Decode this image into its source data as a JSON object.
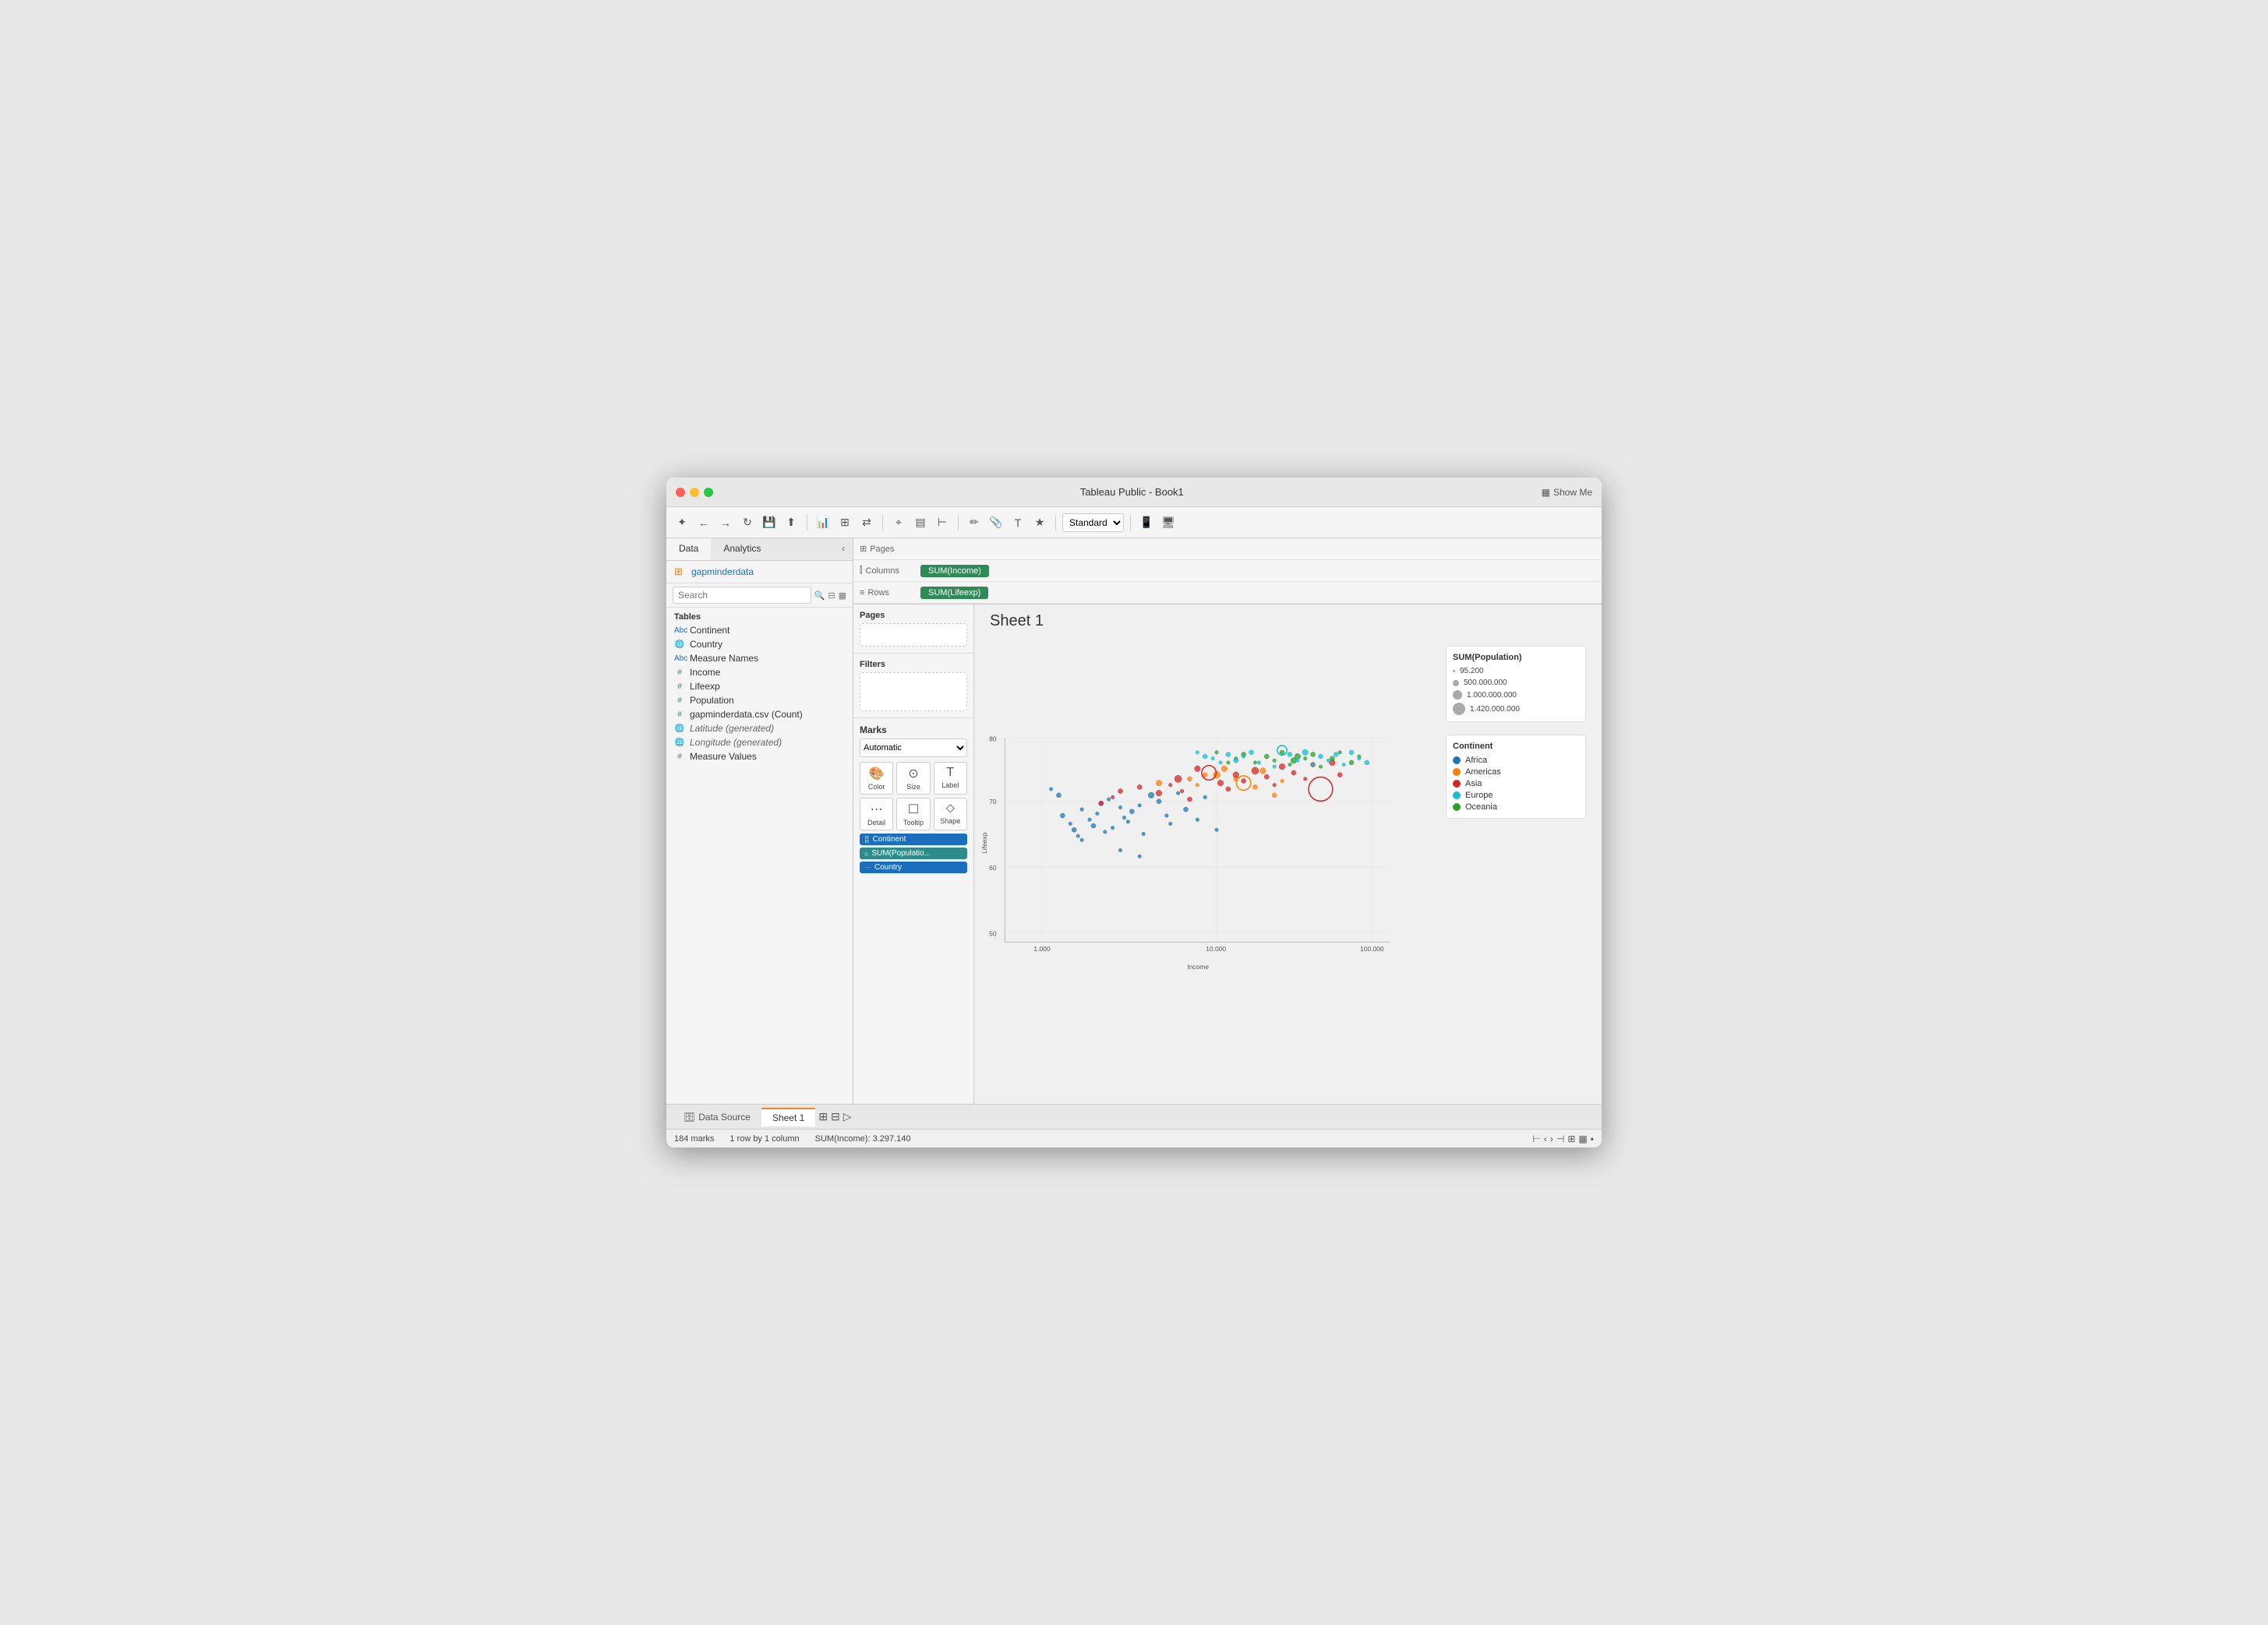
{
  "window": {
    "title": "Tableau Public - Book1"
  },
  "toolbar": {
    "standard_label": "Standard",
    "show_me_label": "Show Me"
  },
  "data_panel": {
    "tab_data": "Data",
    "tab_analytics": "Analytics",
    "datasource": "gapminderdata",
    "search_placeholder": "Search",
    "tables_label": "Tables",
    "fields": [
      {
        "name": "Continent",
        "type": "abc",
        "color": "blue"
      },
      {
        "name": "Country",
        "type": "globe",
        "color": "blue"
      },
      {
        "name": "Measure Names",
        "type": "abc",
        "color": "blue"
      },
      {
        "name": "Income",
        "type": "hash",
        "color": "green"
      },
      {
        "name": "Lifeexp",
        "type": "hash",
        "color": "green"
      },
      {
        "name": "Population",
        "type": "hash",
        "color": "green"
      },
      {
        "name": "gapminderdata.csv (Count)",
        "type": "hash",
        "color": "green"
      },
      {
        "name": "Latitude (generated)",
        "type": "globe",
        "color": "green",
        "italic": true
      },
      {
        "name": "Longitude (generated)",
        "type": "globe",
        "color": "green",
        "italic": true
      },
      {
        "name": "Measure Values",
        "type": "hash",
        "color": "green"
      }
    ]
  },
  "pages_panel": {
    "title": "Pages"
  },
  "filters_panel": {
    "title": "Filters"
  },
  "shelves": {
    "columns_label": "Columns",
    "columns_pill": "SUM(Income)",
    "rows_label": "Rows",
    "rows_pill": "SUM(Lifeexp)"
  },
  "marks": {
    "title": "Marks",
    "type": "Automatic",
    "buttons": [
      {
        "label": "Color",
        "icon": "🎨"
      },
      {
        "label": "Size",
        "icon": "⊙"
      },
      {
        "label": "Label",
        "icon": "T"
      },
      {
        "label": "Detail",
        "icon": "⋯"
      },
      {
        "label": "Tooltip",
        "icon": "☐"
      },
      {
        "label": "Shape",
        "icon": "⬦"
      }
    ],
    "pills": [
      {
        "label": "Continent",
        "icon": "⣿",
        "color": "blue"
      },
      {
        "label": "SUM(Populatio...",
        "icon": "○",
        "color": "teal"
      },
      {
        "label": "Country",
        "icon": "⋯",
        "color": "blue"
      }
    ]
  },
  "chart": {
    "title": "Sheet 1",
    "x_axis_label": "Income",
    "y_axis_label": "Lifeexp",
    "x_ticks": [
      "1.000",
      "10.000",
      "100.000"
    ],
    "y_ticks": [
      "50",
      "60",
      "70",
      "80"
    ],
    "points": [
      {
        "x": 0.15,
        "y": 0.62,
        "r": 4,
        "color": "#1f77b4"
      },
      {
        "x": 0.17,
        "y": 0.58,
        "r": 3,
        "color": "#1f77b4"
      },
      {
        "x": 0.18,
        "y": 0.55,
        "r": 4,
        "color": "#1f77b4"
      },
      {
        "x": 0.19,
        "y": 0.52,
        "r": 3,
        "color": "#1f77b4"
      },
      {
        "x": 0.2,
        "y": 0.65,
        "r": 3,
        "color": "#1f77b4"
      },
      {
        "x": 0.22,
        "y": 0.6,
        "r": 3,
        "color": "#1f77b4"
      },
      {
        "x": 0.23,
        "y": 0.57,
        "r": 4,
        "color": "#1f77b4"
      },
      {
        "x": 0.24,
        "y": 0.63,
        "r": 3,
        "color": "#1f77b4"
      },
      {
        "x": 0.25,
        "y": 0.68,
        "r": 4,
        "color": "#1f77b4"
      },
      {
        "x": 0.26,
        "y": 0.54,
        "r": 3,
        "color": "#1f77b4"
      },
      {
        "x": 0.27,
        "y": 0.7,
        "r": 3,
        "color": "#1f77b4"
      },
      {
        "x": 0.28,
        "y": 0.56,
        "r": 3,
        "color": "#1f77b4"
      },
      {
        "x": 0.3,
        "y": 0.66,
        "r": 3,
        "color": "#1f77b4"
      },
      {
        "x": 0.31,
        "y": 0.61,
        "r": 3,
        "color": "#1f77b4"
      },
      {
        "x": 0.32,
        "y": 0.59,
        "r": 3,
        "color": "#1f77b4"
      },
      {
        "x": 0.33,
        "y": 0.64,
        "r": 4,
        "color": "#1f77b4"
      },
      {
        "x": 0.35,
        "y": 0.67,
        "r": 3,
        "color": "#1f77b4"
      },
      {
        "x": 0.36,
        "y": 0.53,
        "r": 3,
        "color": "#1f77b4"
      },
      {
        "x": 0.38,
        "y": 0.72,
        "r": 5,
        "color": "#1f77b4"
      },
      {
        "x": 0.4,
        "y": 0.69,
        "r": 4,
        "color": "#1f77b4"
      },
      {
        "x": 0.42,
        "y": 0.62,
        "r": 3,
        "color": "#1f77b4"
      },
      {
        "x": 0.43,
        "y": 0.58,
        "r": 3,
        "color": "#1f77b4"
      },
      {
        "x": 0.12,
        "y": 0.75,
        "r": 3,
        "color": "#1f77b4"
      },
      {
        "x": 0.14,
        "y": 0.72,
        "r": 4,
        "color": "#1f77b4"
      },
      {
        "x": 0.45,
        "y": 0.73,
        "r": 3,
        "color": "#1f77b4"
      },
      {
        "x": 0.47,
        "y": 0.65,
        "r": 4,
        "color": "#1f77b4"
      },
      {
        "x": 0.5,
        "y": 0.6,
        "r": 3,
        "color": "#1f77b4"
      },
      {
        "x": 0.2,
        "y": 0.5,
        "r": 3,
        "color": "#1f77b4"
      },
      {
        "x": 0.52,
        "y": 0.71,
        "r": 3,
        "color": "#1f77b4"
      },
      {
        "x": 0.55,
        "y": 0.55,
        "r": 3,
        "color": "#1f77b4"
      },
      {
        "x": 0.3,
        "y": 0.45,
        "r": 3,
        "color": "#1f77b4"
      },
      {
        "x": 0.35,
        "y": 0.42,
        "r": 3,
        "color": "#1f77b4"
      },
      {
        "x": 0.55,
        "y": 0.82,
        "r": 6,
        "color": "#ff7f0e"
      },
      {
        "x": 0.57,
        "y": 0.85,
        "r": 5,
        "color": "#ff7f0e"
      },
      {
        "x": 0.6,
        "y": 0.8,
        "r": 4,
        "color": "#ff7f0e"
      },
      {
        "x": 0.62,
        "y": 0.78,
        "r": 12,
        "color": "#ff7f0e",
        "stroke": true
      },
      {
        "x": 0.65,
        "y": 0.76,
        "r": 4,
        "color": "#ff7f0e"
      },
      {
        "x": 0.67,
        "y": 0.84,
        "r": 5,
        "color": "#ff7f0e"
      },
      {
        "x": 0.7,
        "y": 0.72,
        "r": 4,
        "color": "#ff7f0e"
      },
      {
        "x": 0.72,
        "y": 0.79,
        "r": 3,
        "color": "#ff7f0e"
      },
      {
        "x": 0.48,
        "y": 0.8,
        "r": 4,
        "color": "#ff7f0e"
      },
      {
        "x": 0.5,
        "y": 0.77,
        "r": 3,
        "color": "#ff7f0e"
      },
      {
        "x": 0.52,
        "y": 0.82,
        "r": 4,
        "color": "#ff7f0e"
      },
      {
        "x": 0.4,
        "y": 0.78,
        "r": 5,
        "color": "#ff7f0e"
      },
      {
        "x": 0.35,
        "y": 0.76,
        "r": 4,
        "color": "#d62728"
      },
      {
        "x": 0.4,
        "y": 0.73,
        "r": 5,
        "color": "#d62728"
      },
      {
        "x": 0.45,
        "y": 0.8,
        "r": 6,
        "color": "#d62728"
      },
      {
        "x": 0.5,
        "y": 0.85,
        "r": 5,
        "color": "#d62728"
      },
      {
        "x": 0.53,
        "y": 0.83,
        "r": 12,
        "color": "#d62728",
        "stroke": true
      },
      {
        "x": 0.56,
        "y": 0.78,
        "r": 5,
        "color": "#d62728"
      },
      {
        "x": 0.58,
        "y": 0.75,
        "r": 4,
        "color": "#d62728"
      },
      {
        "x": 0.6,
        "y": 0.82,
        "r": 5,
        "color": "#d62728"
      },
      {
        "x": 0.62,
        "y": 0.79,
        "r": 4,
        "color": "#d62728"
      },
      {
        "x": 0.65,
        "y": 0.84,
        "r": 6,
        "color": "#d62728"
      },
      {
        "x": 0.68,
        "y": 0.81,
        "r": 4,
        "color": "#d62728"
      },
      {
        "x": 0.7,
        "y": 0.77,
        "r": 3,
        "color": "#d62728"
      },
      {
        "x": 0.72,
        "y": 0.86,
        "r": 5,
        "color": "#d62728"
      },
      {
        "x": 0.75,
        "y": 0.83,
        "r": 4,
        "color": "#d62728"
      },
      {
        "x": 0.78,
        "y": 0.8,
        "r": 3,
        "color": "#d62728"
      },
      {
        "x": 0.8,
        "y": 0.87,
        "r": 4,
        "color": "#d62728"
      },
      {
        "x": 0.82,
        "y": 0.75,
        "r": 20,
        "color": "#d62728",
        "stroke": true
      },
      {
        "x": 0.85,
        "y": 0.88,
        "r": 5,
        "color": "#d62728"
      },
      {
        "x": 0.87,
        "y": 0.82,
        "r": 4,
        "color": "#d62728"
      },
      {
        "x": 0.3,
        "y": 0.74,
        "r": 4,
        "color": "#d62728"
      },
      {
        "x": 0.28,
        "y": 0.71,
        "r": 3,
        "color": "#d62728"
      },
      {
        "x": 0.25,
        "y": 0.68,
        "r": 4,
        "color": "#d62728"
      },
      {
        "x": 0.48,
        "y": 0.7,
        "r": 4,
        "color": "#d62728"
      },
      {
        "x": 0.46,
        "y": 0.74,
        "r": 3,
        "color": "#d62728"
      },
      {
        "x": 0.43,
        "y": 0.77,
        "r": 3,
        "color": "#d62728"
      },
      {
        "x": 0.6,
        "y": 0.9,
        "r": 3,
        "color": "#2ca02c"
      },
      {
        "x": 0.62,
        "y": 0.92,
        "r": 4,
        "color": "#2ca02c"
      },
      {
        "x": 0.65,
        "y": 0.88,
        "r": 3,
        "color": "#2ca02c"
      },
      {
        "x": 0.68,
        "y": 0.91,
        "r": 4,
        "color": "#2ca02c"
      },
      {
        "x": 0.7,
        "y": 0.89,
        "r": 3,
        "color": "#2ca02c"
      },
      {
        "x": 0.72,
        "y": 0.93,
        "r": 4,
        "color": "#2ca02c"
      },
      {
        "x": 0.74,
        "y": 0.87,
        "r": 3,
        "color": "#2ca02c"
      },
      {
        "x": 0.76,
        "y": 0.91,
        "r": 5,
        "color": "#2ca02c"
      },
      {
        "x": 0.78,
        "y": 0.9,
        "r": 3,
        "color": "#2ca02c"
      },
      {
        "x": 0.8,
        "y": 0.92,
        "r": 4,
        "color": "#2ca02c"
      },
      {
        "x": 0.75,
        "y": 0.89,
        "r": 5,
        "color": "#2ca02c"
      },
      {
        "x": 0.55,
        "y": 0.93,
        "r": 3,
        "color": "#2ca02c"
      },
      {
        "x": 0.58,
        "y": 0.88,
        "r": 3,
        "color": "#2ca02c"
      },
      {
        "x": 0.82,
        "y": 0.86,
        "r": 3,
        "color": "#2ca02c"
      },
      {
        "x": 0.85,
        "y": 0.9,
        "r": 4,
        "color": "#2ca02c"
      },
      {
        "x": 0.87,
        "y": 0.93,
        "r": 3,
        "color": "#2ca02c"
      },
      {
        "x": 0.9,
        "y": 0.88,
        "r": 4,
        "color": "#2ca02c"
      },
      {
        "x": 0.92,
        "y": 0.91,
        "r": 3,
        "color": "#2ca02c"
      },
      {
        "x": 0.5,
        "y": 0.93,
        "r": 3,
        "color": "#17becf"
      },
      {
        "x": 0.52,
        "y": 0.91,
        "r": 4,
        "color": "#17becf"
      },
      {
        "x": 0.54,
        "y": 0.9,
        "r": 3,
        "color": "#17becf"
      },
      {
        "x": 0.72,
        "y": 0.94,
        "r": 8,
        "color": "#17becf",
        "stroke": true
      },
      {
        "x": 0.56,
        "y": 0.88,
        "r": 3,
        "color": "#17becf"
      },
      {
        "x": 0.58,
        "y": 0.92,
        "r": 4,
        "color": "#17becf"
      },
      {
        "x": 0.7,
        "y": 0.86,
        "r": 3,
        "color": "#17becf"
      },
      {
        "x": 0.74,
        "y": 0.92,
        "r": 4,
        "color": "#17becf"
      },
      {
        "x": 0.76,
        "y": 0.89,
        "r": 3,
        "color": "#17becf"
      },
      {
        "x": 0.78,
        "y": 0.93,
        "r": 5,
        "color": "#17becf"
      },
      {
        "x": 0.8,
        "y": 0.87,
        "r": 3,
        "color": "#17becf"
      },
      {
        "x": 0.82,
        "y": 0.91,
        "r": 4,
        "color": "#17becf"
      },
      {
        "x": 0.84,
        "y": 0.89,
        "r": 3,
        "color": "#17becf"
      },
      {
        "x": 0.86,
        "y": 0.92,
        "r": 4,
        "color": "#17becf"
      },
      {
        "x": 0.88,
        "y": 0.87,
        "r": 3,
        "color": "#17becf"
      },
      {
        "x": 0.9,
        "y": 0.93,
        "r": 4,
        "color": "#17becf"
      },
      {
        "x": 0.92,
        "y": 0.9,
        "r": 3,
        "color": "#17becf"
      },
      {
        "x": 0.94,
        "y": 0.88,
        "r": 4,
        "color": "#17becf"
      },
      {
        "x": 0.6,
        "y": 0.89,
        "r": 4,
        "color": "#17becf"
      },
      {
        "x": 0.62,
        "y": 0.91,
        "r": 3,
        "color": "#17becf"
      },
      {
        "x": 0.64,
        "y": 0.93,
        "r": 4,
        "color": "#17becf"
      },
      {
        "x": 0.66,
        "y": 0.88,
        "r": 3,
        "color": "#17becf"
      }
    ]
  },
  "legend": {
    "size_title": "SUM(Population)",
    "size_items": [
      {
        "label": "95.200",
        "size": 2
      },
      {
        "label": "500.000.000",
        "size": 6
      },
      {
        "label": "1.000.000.000",
        "size": 10
      },
      {
        "label": "1.420.000.000",
        "size": 14
      }
    ],
    "color_title": "Continent",
    "color_items": [
      {
        "label": "Africa",
        "color": "#1f77b4"
      },
      {
        "label": "Americas",
        "color": "#ff7f0e"
      },
      {
        "label": "Asia",
        "color": "#d62728"
      },
      {
        "label": "Europe",
        "color": "#17becf"
      },
      {
        "label": "Oceania",
        "color": "#2ca02c"
      }
    ]
  },
  "bottom_tabs": {
    "data_source": "Data Source",
    "sheet1": "Sheet 1"
  },
  "status_bar": {
    "marks": "184 marks",
    "rows": "1 row by 1 column",
    "sum": "SUM(Income): 3.297.140"
  }
}
